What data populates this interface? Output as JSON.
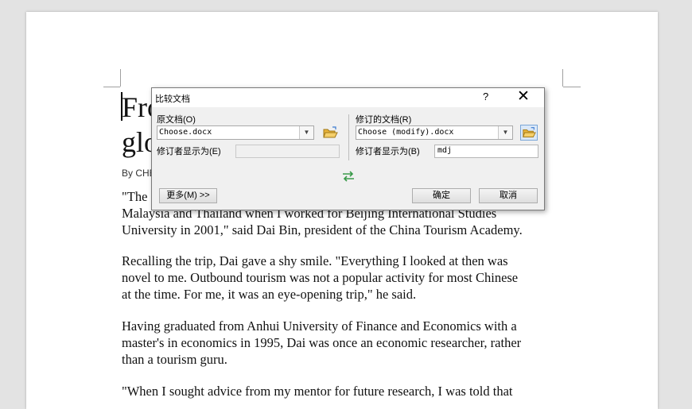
{
  "document": {
    "title_line1": "Fro",
    "title_line2": "glo",
    "byline": "By CHE",
    "paragraphs": [
      {
        "lines": [
          "\"The",
          "Malaysia and Thailand when I worked for Beijing International Studies",
          "University in 2001,\" said Dai Bin, president of the China Tourism Academy."
        ]
      },
      {
        "lines": [
          "Recalling the trip, Dai gave a shy smile. \"Everything I looked at then was",
          "novel to me. Outbound tourism was not a popular activity for most Chinese",
          "at the time. For me, it was an eye-opening trip,\" he said."
        ]
      },
      {
        "lines": [
          "Having graduated from Anhui University of Finance and Economics with a",
          "master's in economics in 1995, Dai was once an economic researcher, rather",
          "than a tourism guru."
        ]
      },
      {
        "lines": [
          "\"When I sought advice from my mentor for future research, I was told that"
        ]
      }
    ]
  },
  "dialog": {
    "title": "比较文档",
    "help": "?",
    "close": "✕",
    "original": {
      "label": "原文档(O)",
      "file": "Choose.docx",
      "author_label": "修订者显示为(E)",
      "author_value": ""
    },
    "revised": {
      "label": "修订的文档(R)",
      "file": "Choose (modify).docx",
      "author_label": "修订者显示为(B)",
      "author_value": "mdj"
    },
    "more_button": "更多(M) >>",
    "ok_button": "确定",
    "cancel_button": "取消"
  },
  "colors": {
    "swap_icon": "#3a9a4a",
    "folder_icon": "#e8b33a"
  }
}
